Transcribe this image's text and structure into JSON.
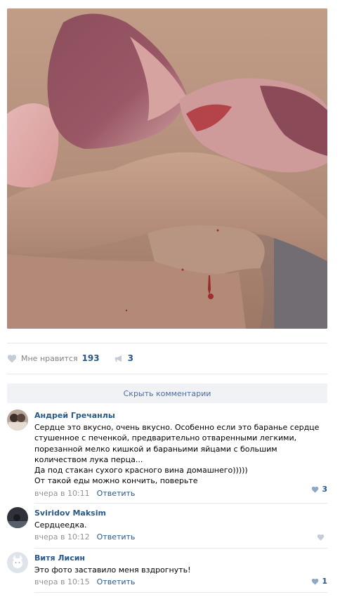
{
  "post": {
    "likes_label": "Мне нравится",
    "likes_count": "193",
    "shares_count": "3"
  },
  "comments_toggle": "Скрыть комментарии",
  "comments": [
    {
      "author": "Андрей Гречанлы",
      "text": "Сердце это вкусно, очень вкусно. Особенно если это баранье сердце стушенное с печенкой, предварительно отваренными легкими, порезанной мелко кишкой и бараньими яйцами с большим количеством лука перца...\nДа под стакан сухого красного вина домашнего)))))\nОт такой еды можно кончить, поверьте",
      "time": "вчера в 10:11",
      "reply": "Ответить",
      "likes": "3"
    },
    {
      "author": "Sviridov Maksim",
      "text": "Сердцеедка.",
      "time": "вчера в 10:12",
      "reply": "Ответить",
      "likes": ""
    },
    {
      "author": "Витя Лисин",
      "text": "Это фото заставило меня вздрогнуть!",
      "time": "вчера в 10:15",
      "reply": "Ответить",
      "likes": "1"
    }
  ],
  "colors": {
    "link": "#2a5885",
    "muted": "#939393",
    "separator": "#e7e8ec",
    "toggle_bg": "#f0f2f5",
    "heart_gray": "#c5ccd6",
    "heart_blue": "#8fa7c2"
  }
}
